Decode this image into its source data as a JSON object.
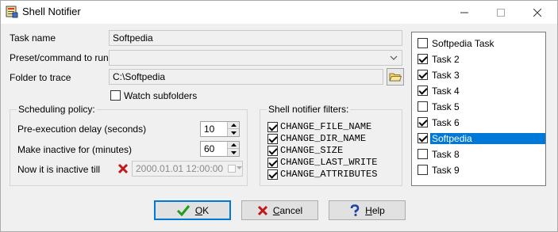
{
  "window": {
    "title": "Shell Notifier",
    "icon": "app-icon"
  },
  "form": {
    "task_name_label": "Task name",
    "task_name_value": "Softpedia",
    "preset_label": "Preset/command to run",
    "preset_value": "",
    "folder_label": "Folder to trace",
    "folder_value": "C:\\Softpedia",
    "watch_subfolders_label": "Watch subfolders",
    "watch_subfolders_checked": false
  },
  "scheduling": {
    "title": "Scheduling policy:",
    "pre_delay_label": "Pre-execution delay (seconds)",
    "pre_delay_value": "10",
    "inactive_for_label": "Make inactive for (minutes)",
    "inactive_for_value": "60",
    "inactive_till_label": "Now it is inactive till",
    "inactive_till_value": "2000.01.01 12:00:00"
  },
  "filters": {
    "title": "Shell notifier filters:",
    "items": [
      {
        "label": "CHANGE_FILE_NAME",
        "checked": true
      },
      {
        "label": "CHANGE_DIR_NAME",
        "checked": true
      },
      {
        "label": "CHANGE_SIZE",
        "checked": true
      },
      {
        "label": "CHANGE_LAST_WRITE",
        "checked": true
      },
      {
        "label": "CHANGE_ATTRIBUTES",
        "checked": true
      }
    ]
  },
  "tasks": [
    {
      "label": "Softpedia Task",
      "checked": false
    },
    {
      "label": "Task 2",
      "checked": true
    },
    {
      "label": "Task 3",
      "checked": true
    },
    {
      "label": "Task 4",
      "checked": true
    },
    {
      "label": "Task 5",
      "checked": false
    },
    {
      "label": "Task 6",
      "checked": true
    },
    {
      "label": "Softpedia",
      "checked": true,
      "selected": true
    },
    {
      "label": "Task 8",
      "checked": false
    },
    {
      "label": "Task 9",
      "checked": false
    }
  ],
  "buttons": {
    "ok_mnemonic": "O",
    "ok_rest": "K",
    "cancel_mnemonic": "C",
    "cancel_rest": "ancel",
    "help_mnemonic": "H",
    "help_rest": "elp"
  },
  "colors": {
    "selection": "#0078d7",
    "ok_check": "#1f9d1f",
    "cancel_x": "#c01818",
    "help_q": "#1c3fa8"
  }
}
